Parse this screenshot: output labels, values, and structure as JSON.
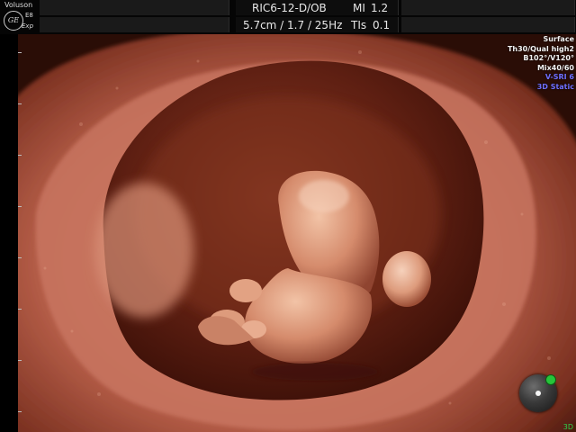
{
  "brand": {
    "line1": "Voluson",
    "logo_text": "GE",
    "model": "E8",
    "model_sub": "Exp"
  },
  "header": {
    "probe_mode": "RIC6-12-D/OB",
    "mi_label": "MI",
    "mi_value": "1.2",
    "depth_info": "5.7cm / 1.7 / 25Hz",
    "tis_label": "TIs",
    "tis_value": "0.1"
  },
  "render_info": {
    "mode": "Surface",
    "quality": "Th30/Qual high2",
    "angles": "B102°/V120°",
    "mix": "Mix40/60",
    "sri": "V-SRI 6",
    "view": "3D Static"
  },
  "footer": {
    "mode_tag": "3D"
  },
  "colors": {
    "accent_green": "#2fd44a",
    "info_blue": "#6f6fff",
    "tissue": "#c8745a"
  },
  "icons": {
    "orientation": "orientation-sphere-icon",
    "logo": "ge-logo-icon"
  }
}
